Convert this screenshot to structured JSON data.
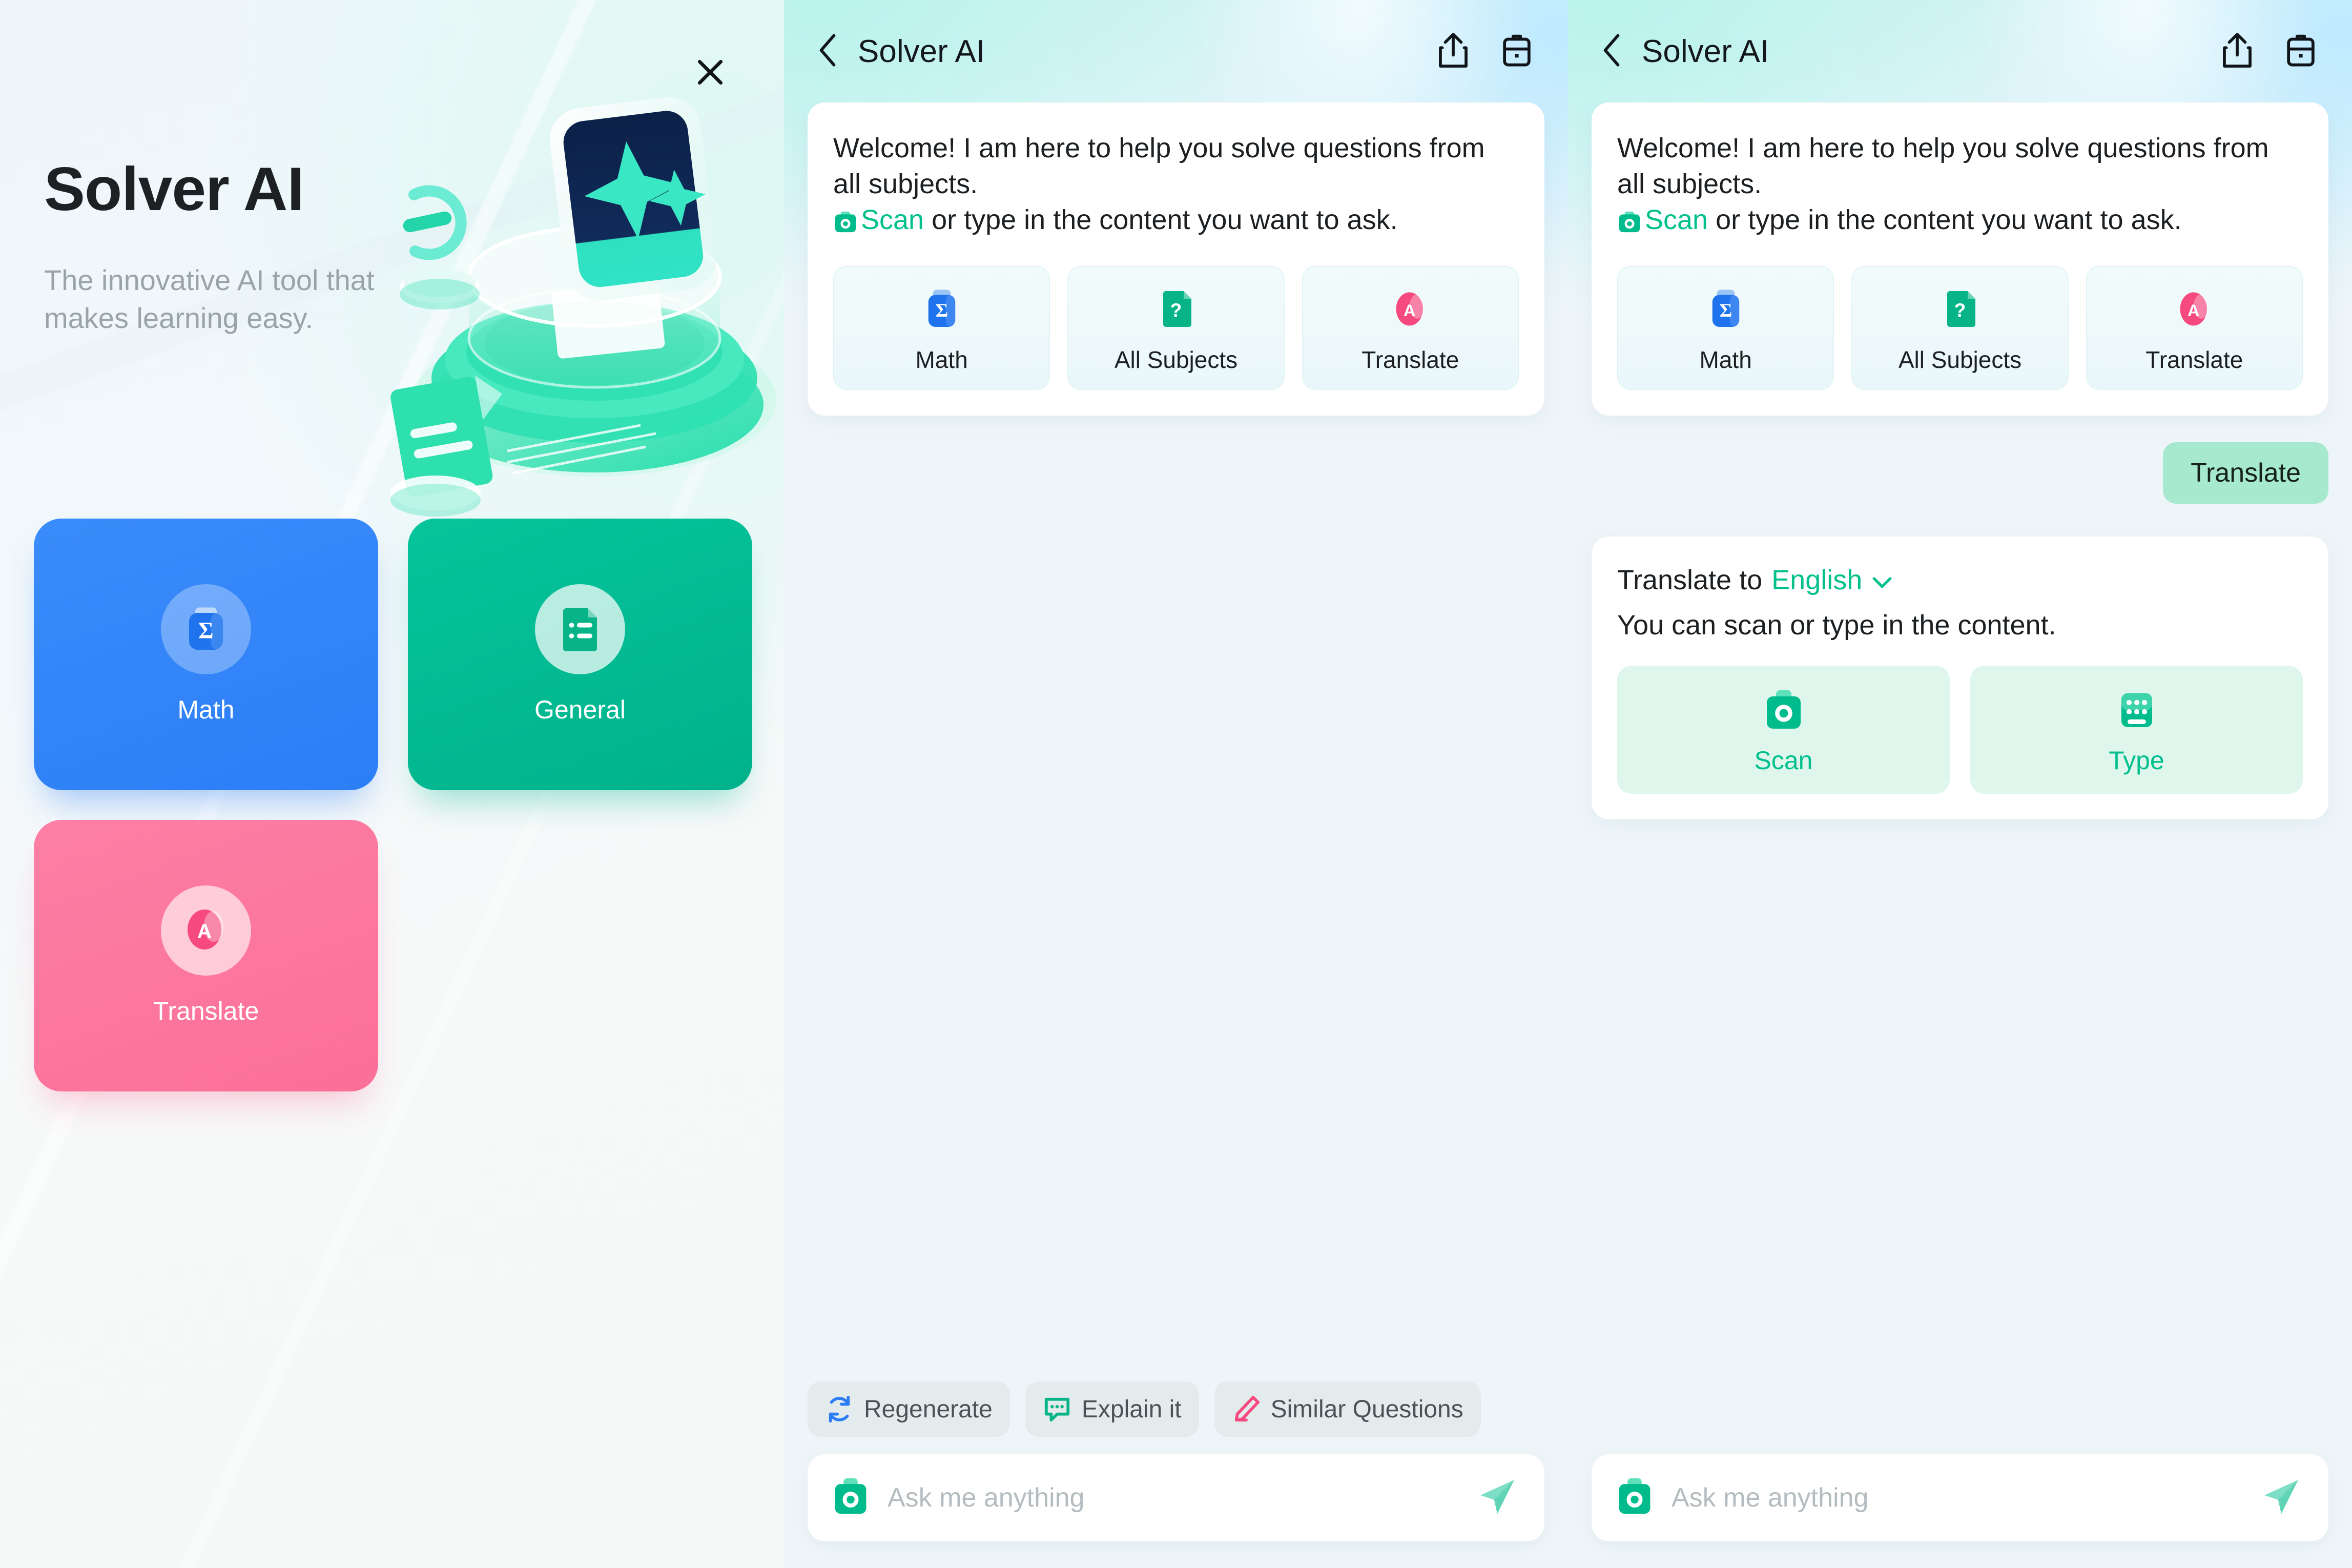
{
  "colors": {
    "accent_green": "#00c08b",
    "math_blue": "#2b7ef5",
    "general_green": "#00b28c",
    "translate_pink": "#fb6f97",
    "user_bubble": "#a6e9cf",
    "panel_bg": "#eef5f8",
    "chip_bg": "#e3ebec"
  },
  "panel1": {
    "close_icon": "close-icon",
    "title": "Solver AI",
    "subtitle": "The innovative AI tool that makes learning easy.",
    "hero_icon": "sparkle-device-illustration",
    "cards": [
      {
        "label": "Math",
        "icon": "sigma-math-icon",
        "color": "#2b7ef5"
      },
      {
        "label": "General",
        "icon": "document-list-icon",
        "color": "#00b28c"
      },
      {
        "label": "Translate",
        "icon": "letter-a-translate-icon",
        "color": "#fb6f97"
      }
    ]
  },
  "panel2": {
    "header": {
      "back_icon": "chevron-left-icon",
      "title": "Solver AI",
      "share_icon": "share-icon",
      "history_icon": "briefcase-history-icon"
    },
    "sparkle_icon": "sparkle-icon",
    "welcome": {
      "line1": "Welcome! I am here to help you solve questions from all subjects.",
      "scan_icon": "camera-scan-icon",
      "scan_label": "Scan",
      "line2_rest": " or type in the content you want to ask."
    },
    "subject_chips": [
      {
        "label": "Math",
        "icon": "sigma-math-icon"
      },
      {
        "label": "All Subjects",
        "icon": "question-doc-icon"
      },
      {
        "label": "Translate",
        "icon": "letter-a-translate-icon"
      }
    ],
    "action_chips": [
      {
        "label": "Regenerate",
        "icon": "refresh-icon"
      },
      {
        "label": "Explain it",
        "icon": "chat-bubble-icon"
      },
      {
        "label": "Similar Questions",
        "icon": "pencil-icon"
      }
    ],
    "composer": {
      "camera_icon": "camera-scan-icon",
      "placeholder": "Ask me anything",
      "value": "",
      "send_icon": "send-icon"
    }
  },
  "panel3": {
    "header": {
      "back_icon": "chevron-left-icon",
      "title": "Solver AI",
      "share_icon": "share-icon",
      "history_icon": "briefcase-history-icon"
    },
    "welcome": {
      "line1": "Welcome! I am here to help you solve questions from all subjects.",
      "scan_icon": "camera-scan-icon",
      "scan_label": "Scan",
      "line2_rest": " or type in the content you want to ask."
    },
    "subject_chips": [
      {
        "label": "Math",
        "icon": "sigma-math-icon"
      },
      {
        "label": "All Subjects",
        "icon": "question-doc-icon"
      },
      {
        "label": "Translate",
        "icon": "letter-a-translate-icon"
      }
    ],
    "user_message": "Translate",
    "translate": {
      "prefix": "Translate to",
      "language": "English",
      "caret_icon": "chevron-down-icon",
      "hint": "You can scan or type in the content.",
      "actions": [
        {
          "label": "Scan",
          "icon": "camera-scan-icon"
        },
        {
          "label": "Type",
          "icon": "keyboard-icon"
        }
      ]
    },
    "composer": {
      "camera_icon": "camera-scan-icon",
      "placeholder": "Ask me anything",
      "value": "",
      "send_icon": "send-icon"
    }
  }
}
